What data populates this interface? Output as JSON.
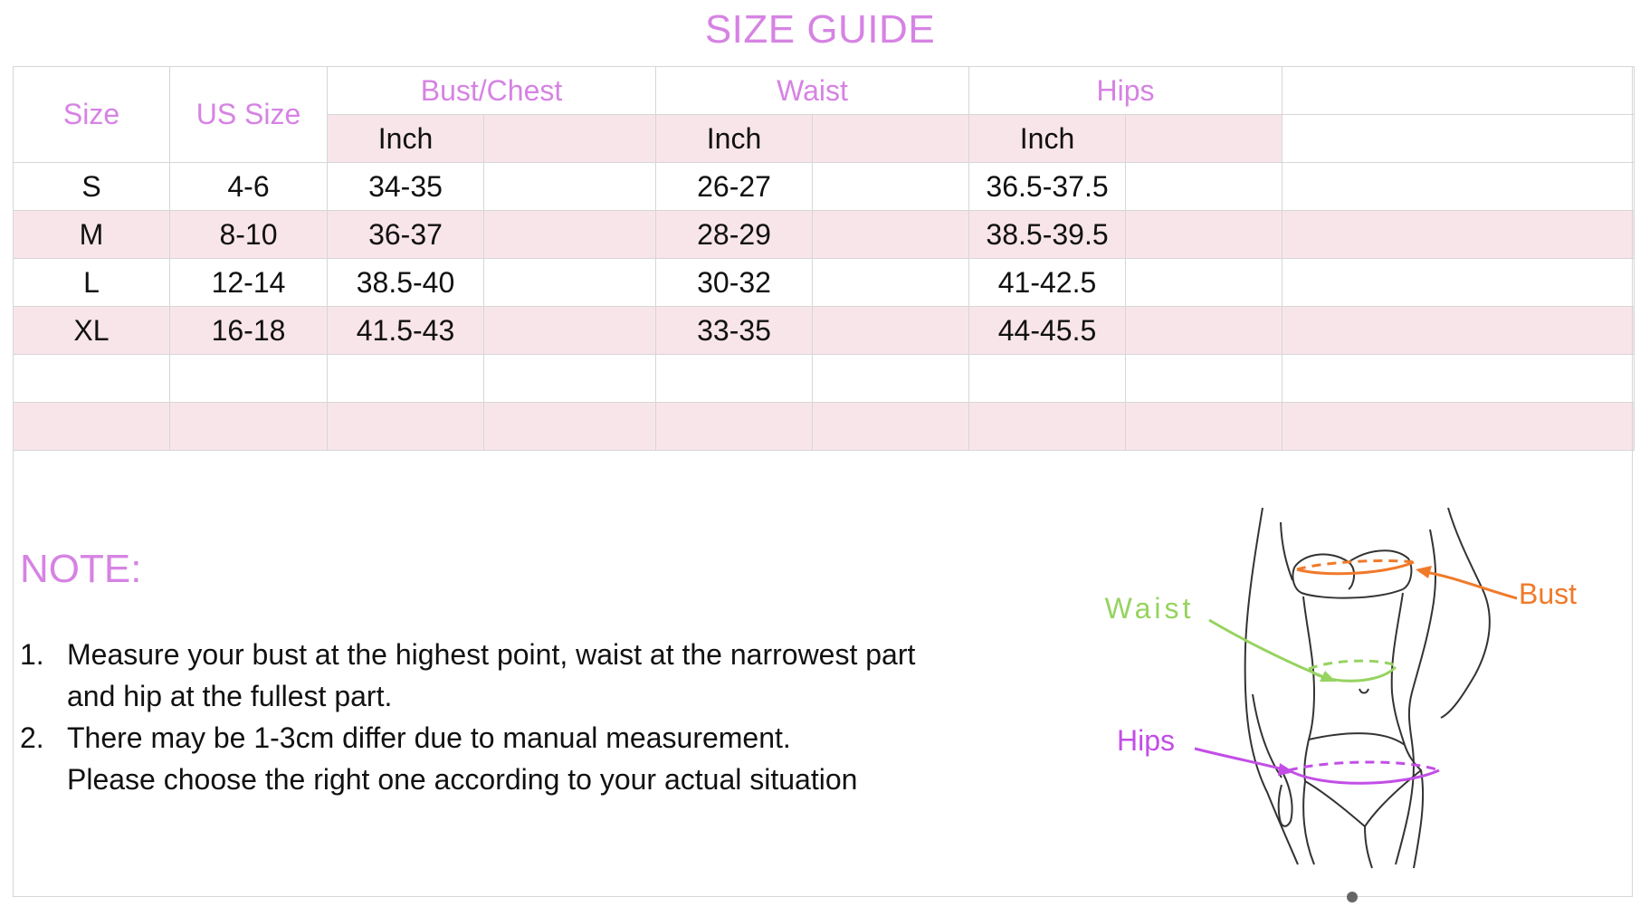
{
  "title": "SIZE GUIDE",
  "table": {
    "headers": {
      "size": "Size",
      "us_size": "US Size",
      "bust": "Bust/Chest",
      "waist": "Waist",
      "hips": "Hips",
      "unit": "Inch"
    },
    "rows": [
      {
        "size": "S",
        "us": "4-6",
        "bust": "34-35",
        "waist": "26-27",
        "hips": "36.5-37.5"
      },
      {
        "size": "M",
        "us": "8-10",
        "bust": "36-37",
        "waist": "28-29",
        "hips": "38.5-39.5"
      },
      {
        "size": "L",
        "us": "12-14",
        "bust": "38.5-40",
        "waist": "30-32",
        "hips": "41-42.5"
      },
      {
        "size": "XL",
        "us": "16-18",
        "bust": "41.5-43",
        "waist": "33-35",
        "hips": "44-45.5"
      }
    ]
  },
  "note": {
    "title": "NOTE:",
    "items": [
      {
        "num": "1.",
        "line1": "Measure your bust at the highest point, waist at the narrowest part",
        "line2": "and hip at the fullest part."
      },
      {
        "num": "2.",
        "line1": "There may be 1-3cm differ due to manual measurement.",
        "line2": "Please choose the right one according to your actual situation"
      }
    ]
  },
  "figure": {
    "labels": {
      "bust": "Bust",
      "waist": "Waist",
      "hips": "Hips"
    },
    "colors": {
      "bust": "#f07a2a",
      "waist": "#96d35f",
      "hips": "#c24ee6",
      "pink": "#d683e3",
      "shade": "#f8e5ea"
    }
  }
}
